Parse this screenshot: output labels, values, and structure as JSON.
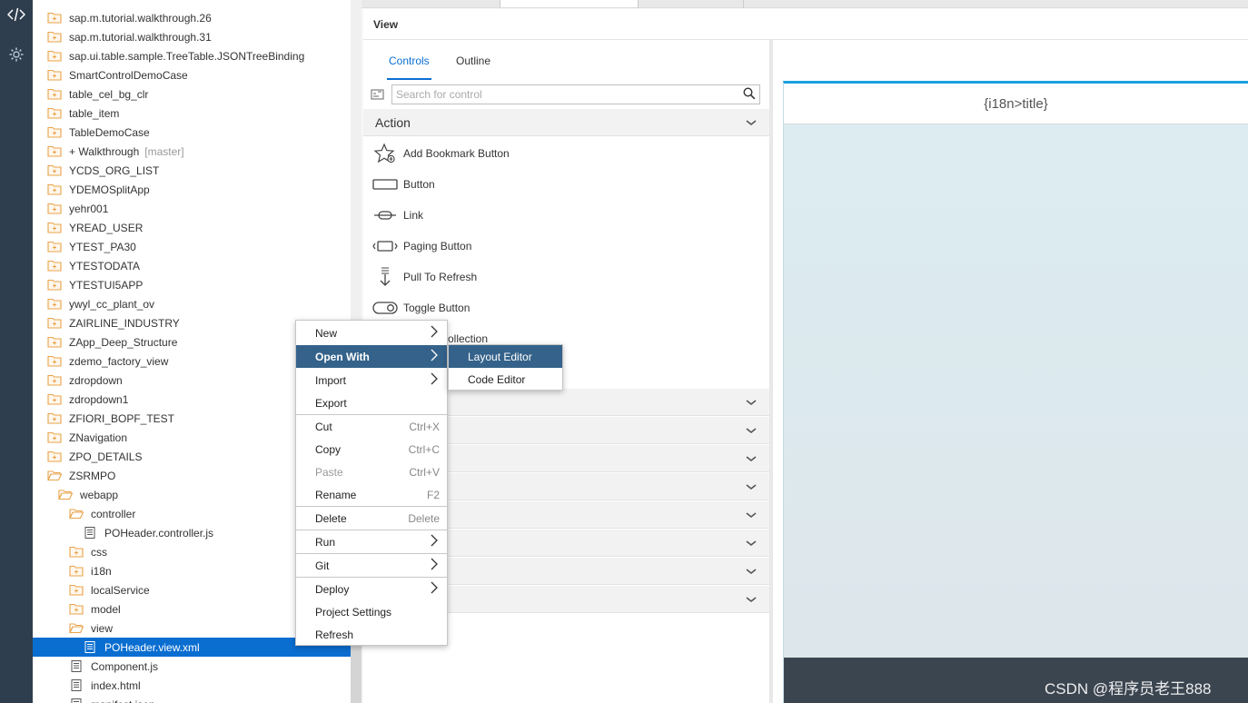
{
  "activity_bar": {
    "items": [
      {
        "icon": "code-icon",
        "label": "</>"
      },
      {
        "icon": "gear-icon"
      }
    ]
  },
  "tree": {
    "items": [
      {
        "label": "sap.m.tutorial.walkthrough.26",
        "icon": "folder-closed-icon"
      },
      {
        "label": "sap.m.tutorial.walkthrough.31",
        "icon": "folder-closed-icon"
      },
      {
        "label": "sap.ui.table.sample.TreeTable.JSONTreeBinding",
        "icon": "folder-closed-icon"
      },
      {
        "label": "SmartControlDemoCase",
        "icon": "folder-closed-icon"
      },
      {
        "label": "table_cel_bg_clr",
        "icon": "folder-closed-icon"
      },
      {
        "label": "table_item",
        "icon": "folder-closed-icon"
      },
      {
        "label": "TableDemoCase",
        "icon": "folder-closed-icon"
      },
      {
        "label": "+ Walkthrough",
        "tag": "[master]",
        "icon": "folder-closed-icon"
      },
      {
        "label": "YCDS_ORG_LIST",
        "icon": "folder-closed-icon"
      },
      {
        "label": "YDEMOSplitApp",
        "icon": "folder-closed-icon"
      },
      {
        "label": "yehr001",
        "icon": "folder-closed-icon"
      },
      {
        "label": "YREAD_USER",
        "icon": "folder-closed-icon"
      },
      {
        "label": "YTEST_PA30",
        "icon": "folder-closed-icon"
      },
      {
        "label": "YTESTODATA",
        "icon": "folder-closed-icon"
      },
      {
        "label": "YTESTUI5APP",
        "icon": "folder-closed-icon"
      },
      {
        "label": "ywyl_cc_plant_ov",
        "icon": "folder-closed-icon"
      },
      {
        "label": "ZAIRLINE_INDUSTRY",
        "icon": "folder-closed-icon"
      },
      {
        "label": "ZApp_Deep_Structure",
        "icon": "folder-closed-icon"
      },
      {
        "label": "zdemo_factory_view",
        "icon": "folder-closed-icon"
      },
      {
        "label": "zdropdown",
        "icon": "folder-closed-icon"
      },
      {
        "label": "zdropdown1",
        "icon": "folder-closed-icon"
      },
      {
        "label": "ZFIORI_BOPF_TEST",
        "icon": "folder-closed-icon"
      },
      {
        "label": "ZNavigation",
        "icon": "folder-closed-icon"
      },
      {
        "label": "ZPO_DETAILS",
        "icon": "folder-closed-icon"
      },
      {
        "label": "ZSRMPO",
        "icon": "folder-open-icon"
      },
      {
        "label": "webapp",
        "icon": "folder-open-icon"
      },
      {
        "label": "controller",
        "icon": "folder-open-icon"
      },
      {
        "label": "POHeader.controller.js",
        "icon": "file-icon"
      },
      {
        "label": "css",
        "icon": "folder-closed-icon"
      },
      {
        "label": "i18n",
        "icon": "folder-closed-icon"
      },
      {
        "label": "localService",
        "icon": "folder-closed-icon"
      },
      {
        "label": "model",
        "icon": "folder-closed-icon"
      },
      {
        "label": "view",
        "icon": "folder-open-icon"
      },
      {
        "label": "POHeader.view.xml",
        "icon": "file-icon",
        "selected": true
      },
      {
        "label": "Component.js",
        "icon": "file-icon"
      },
      {
        "label": "index.html",
        "icon": "file-icon"
      },
      {
        "label": "manifest.json",
        "icon": "file-icon"
      }
    ]
  },
  "view_panel": {
    "title": "View",
    "tabs": [
      {
        "label": "Controls",
        "active": true
      },
      {
        "label": "Outline",
        "active": false
      }
    ],
    "search": {
      "placeholder": "Search for control",
      "value": ""
    },
    "sections": [
      {
        "title": "Action",
        "expanded": true,
        "items": [
          {
            "label": "Add Bookmark Button",
            "icon": "bookmark-star-icon"
          },
          {
            "label": "Button",
            "icon": "button-icon"
          },
          {
            "label": "Link",
            "icon": "link-icon"
          },
          {
            "label": "Paging Button",
            "icon": "paging-button-icon"
          },
          {
            "label": "Pull To Refresh",
            "icon": "pull-to-refresh-icon"
          },
          {
            "label": "Toggle Button",
            "icon": "toggle-button-icon"
          },
          {
            "label": "ollection",
            "icon": ""
          }
        ]
      }
    ],
    "collapsed_section_count": 8
  },
  "preview": {
    "header_title": "{i18n>title}"
  },
  "watermark": "CSDN @程序员老王888",
  "context_menu": {
    "items": [
      {
        "label": "New",
        "submenu": true
      },
      {
        "label": "Open With",
        "submenu": true,
        "highlighted": true
      },
      {
        "label": "Import",
        "submenu": true
      },
      {
        "label": "Export"
      },
      {
        "label": "Cut",
        "shortcut": "Ctrl+X"
      },
      {
        "label": "Copy",
        "shortcut": "Ctrl+C"
      },
      {
        "label": "Paste",
        "shortcut": "Ctrl+V",
        "disabled": true
      },
      {
        "label": "Rename",
        "shortcut": "F2"
      },
      {
        "label": "Delete",
        "shortcut": "Delete"
      },
      {
        "label": "Run",
        "submenu": true
      },
      {
        "label": "Git",
        "submenu": true
      },
      {
        "label": "Deploy",
        "submenu": true
      },
      {
        "label": "Project Settings"
      },
      {
        "label": "Refresh"
      }
    ],
    "submenu": {
      "items": [
        {
          "label": "Layout Editor",
          "highlighted": true
        },
        {
          "label": "Code Editor"
        }
      ]
    }
  },
  "colors": {
    "accent": "#0a6ed1",
    "menu_highlight": "#34628a",
    "sidebar": "#2f3e4e",
    "folder": "#e8a34a"
  }
}
